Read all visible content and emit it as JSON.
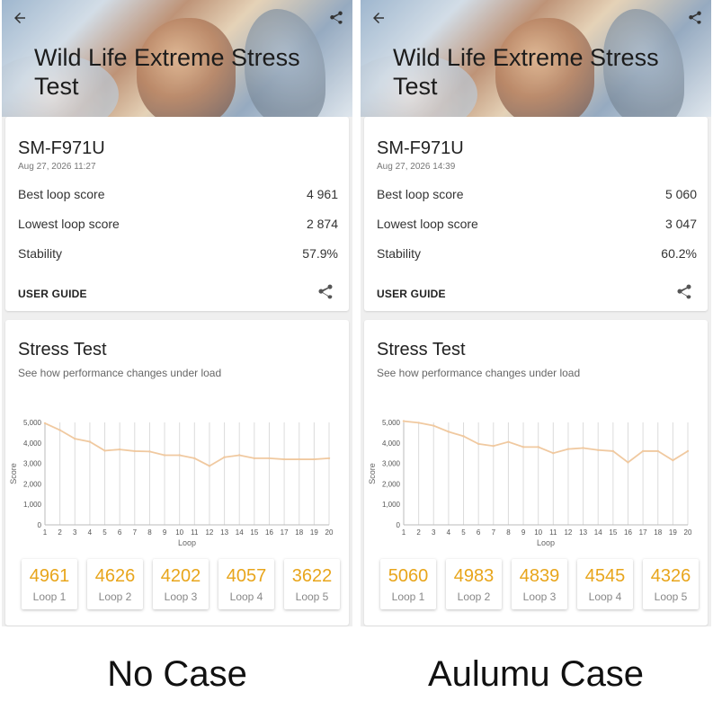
{
  "panels": [
    {
      "title": "Wild Life Extreme Stress Test",
      "device": "SM-F971U",
      "date": "Aug 27, 2026 11:27",
      "best_label": "Best loop score",
      "best_value": "4 961",
      "lowest_label": "Lowest loop score",
      "lowest_value": "2 874",
      "stability_label": "Stability",
      "stability_value": "57.9%",
      "guide_label": "USER GUIDE",
      "stress_title": "Stress Test",
      "stress_subtitle": "See how performance changes under load",
      "loops": [
        {
          "value": "4961",
          "label": "Loop 1"
        },
        {
          "value": "4626",
          "label": "Loop 2"
        },
        {
          "value": "4202",
          "label": "Loop 3"
        },
        {
          "value": "4057",
          "label": "Loop 4"
        },
        {
          "value": "3622",
          "label": "Loop 5"
        }
      ],
      "caption": "No Case"
    },
    {
      "title": "Wild Life Extreme Stress Test",
      "device": "SM-F971U",
      "date": "Aug 27, 2026 14:39",
      "best_label": "Best loop score",
      "best_value": "5 060",
      "lowest_label": "Lowest loop score",
      "lowest_value": "3 047",
      "stability_label": "Stability",
      "stability_value": "60.2%",
      "guide_label": "USER GUIDE",
      "stress_title": "Stress Test",
      "stress_subtitle": "See how performance changes under load",
      "loops": [
        {
          "value": "5060",
          "label": "Loop 1"
        },
        {
          "value": "4983",
          "label": "Loop 2"
        },
        {
          "value": "4839",
          "label": "Loop 3"
        },
        {
          "value": "4545",
          "label": "Loop 4"
        },
        {
          "value": "4326",
          "label": "Loop 5"
        }
      ],
      "caption": "Aulumu Case"
    }
  ],
  "icons": {
    "back": "arrow-left-icon",
    "share": "share-icon"
  },
  "colors": {
    "accent": "#e8a51b",
    "line": "#f0c9a0"
  },
  "chart_data": [
    {
      "type": "line",
      "xlabel": "Loop",
      "ylabel": "Score",
      "ylim": [
        0,
        5000
      ],
      "yticks": [
        "0",
        "1,000",
        "2,000",
        "3,000",
        "4,000",
        "5,000"
      ],
      "x": [
        1,
        2,
        3,
        4,
        5,
        6,
        7,
        8,
        9,
        10,
        11,
        12,
        13,
        14,
        15,
        16,
        17,
        18,
        19,
        20
      ],
      "values": [
        4961,
        4626,
        4202,
        4057,
        3622,
        3680,
        3600,
        3580,
        3400,
        3400,
        3250,
        2874,
        3300,
        3400,
        3250,
        3250,
        3200,
        3200,
        3200,
        3250
      ],
      "grid": "vertical"
    },
    {
      "type": "line",
      "xlabel": "Loop",
      "ylabel": "Score",
      "ylim": [
        0,
        5000
      ],
      "yticks": [
        "0",
        "1,000",
        "2,000",
        "3,000",
        "4,000",
        "5,000"
      ],
      "x": [
        1,
        2,
        3,
        4,
        5,
        6,
        7,
        8,
        9,
        10,
        11,
        12,
        13,
        14,
        15,
        16,
        17,
        18,
        19,
        20
      ],
      "values": [
        5060,
        4983,
        4839,
        4545,
        4326,
        3950,
        3850,
        4050,
        3800,
        3800,
        3500,
        3700,
        3750,
        3650,
        3600,
        3047,
        3600,
        3600,
        3150,
        3600
      ],
      "grid": "vertical"
    }
  ]
}
